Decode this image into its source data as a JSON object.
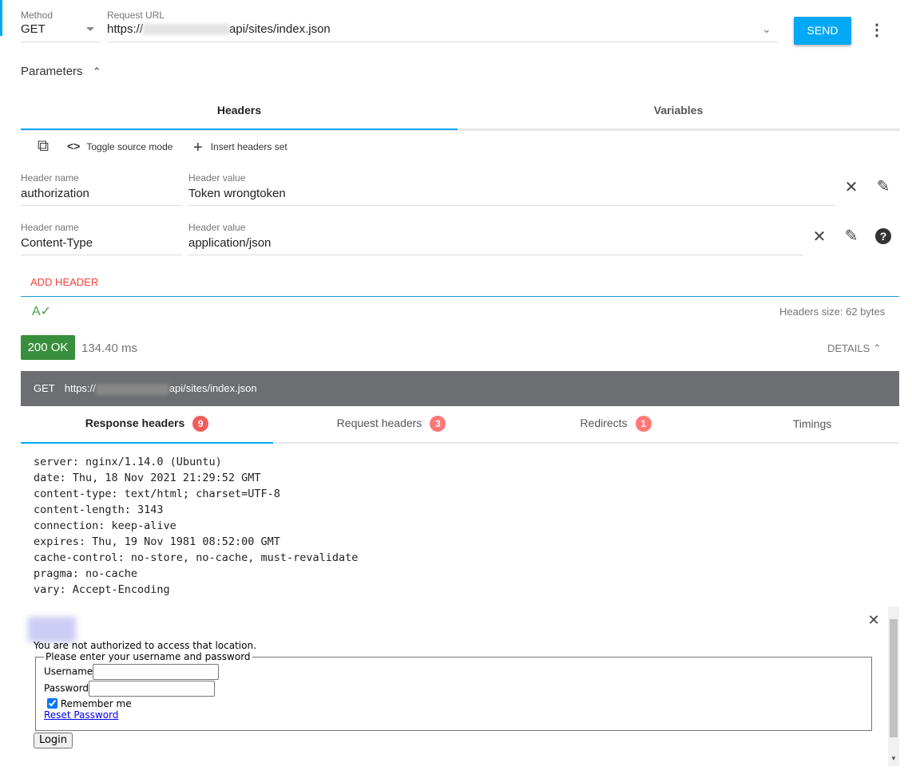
{
  "request": {
    "method_label": "Method",
    "method": "GET",
    "url_label": "Request URL",
    "url_prefix": "https://",
    "url_suffix": "api/sites/index.json",
    "send": "SEND"
  },
  "parameters": {
    "title": "Parameters",
    "tabs": [
      "Headers",
      "Variables"
    ],
    "active_tab": "Headers",
    "toolbar": {
      "toggle_source": "Toggle source mode",
      "insert_set": "Insert headers set"
    },
    "headers": [
      {
        "name_label": "Header name",
        "name": "authorization",
        "value_label": "Header value",
        "value": "Token wrongtoken"
      },
      {
        "name_label": "Header name",
        "name": "Content-Type",
        "value_label": "Header value",
        "value": "application/json"
      }
    ],
    "add_header": "ADD HEADER",
    "headers_size": "Headers size: 62 bytes"
  },
  "response": {
    "status": "200 OK",
    "status_color": "#388e3c",
    "time": "134.40 ms",
    "details": "DETAILS",
    "method": "GET",
    "url_prefix": "https://",
    "url_suffix": "api/sites/index.json",
    "tabs": [
      {
        "label": "Response headers",
        "count": "9"
      },
      {
        "label": "Request headers",
        "count": "3"
      },
      {
        "label": "Redirects",
        "count": "1"
      },
      {
        "label": "Timings"
      }
    ],
    "headers_lines": [
      "server: nginx/1.14.0 (Ubuntu)",
      "date: Thu, 18 Nov 2021 21:29:52 GMT",
      "content-type: text/html; charset=UTF-8",
      "content-length: 3143",
      "connection: keep-alive",
      "expires: Thu, 19 Nov 1981 08:52:00 GMT",
      "cache-control: no-store, no-cache, must-revalidate",
      "pragma: no-cache",
      "vary: Accept-Encoding"
    ]
  },
  "preview": {
    "message": "You are not authorized to access that location.",
    "legend": "Please enter your username and password",
    "username": "Username",
    "password": "Password",
    "remember": "Remember me",
    "reset": "Reset Password",
    "login": "Login"
  },
  "colors": {
    "accent": "#03a9f4",
    "badge": "#f45b5b"
  }
}
